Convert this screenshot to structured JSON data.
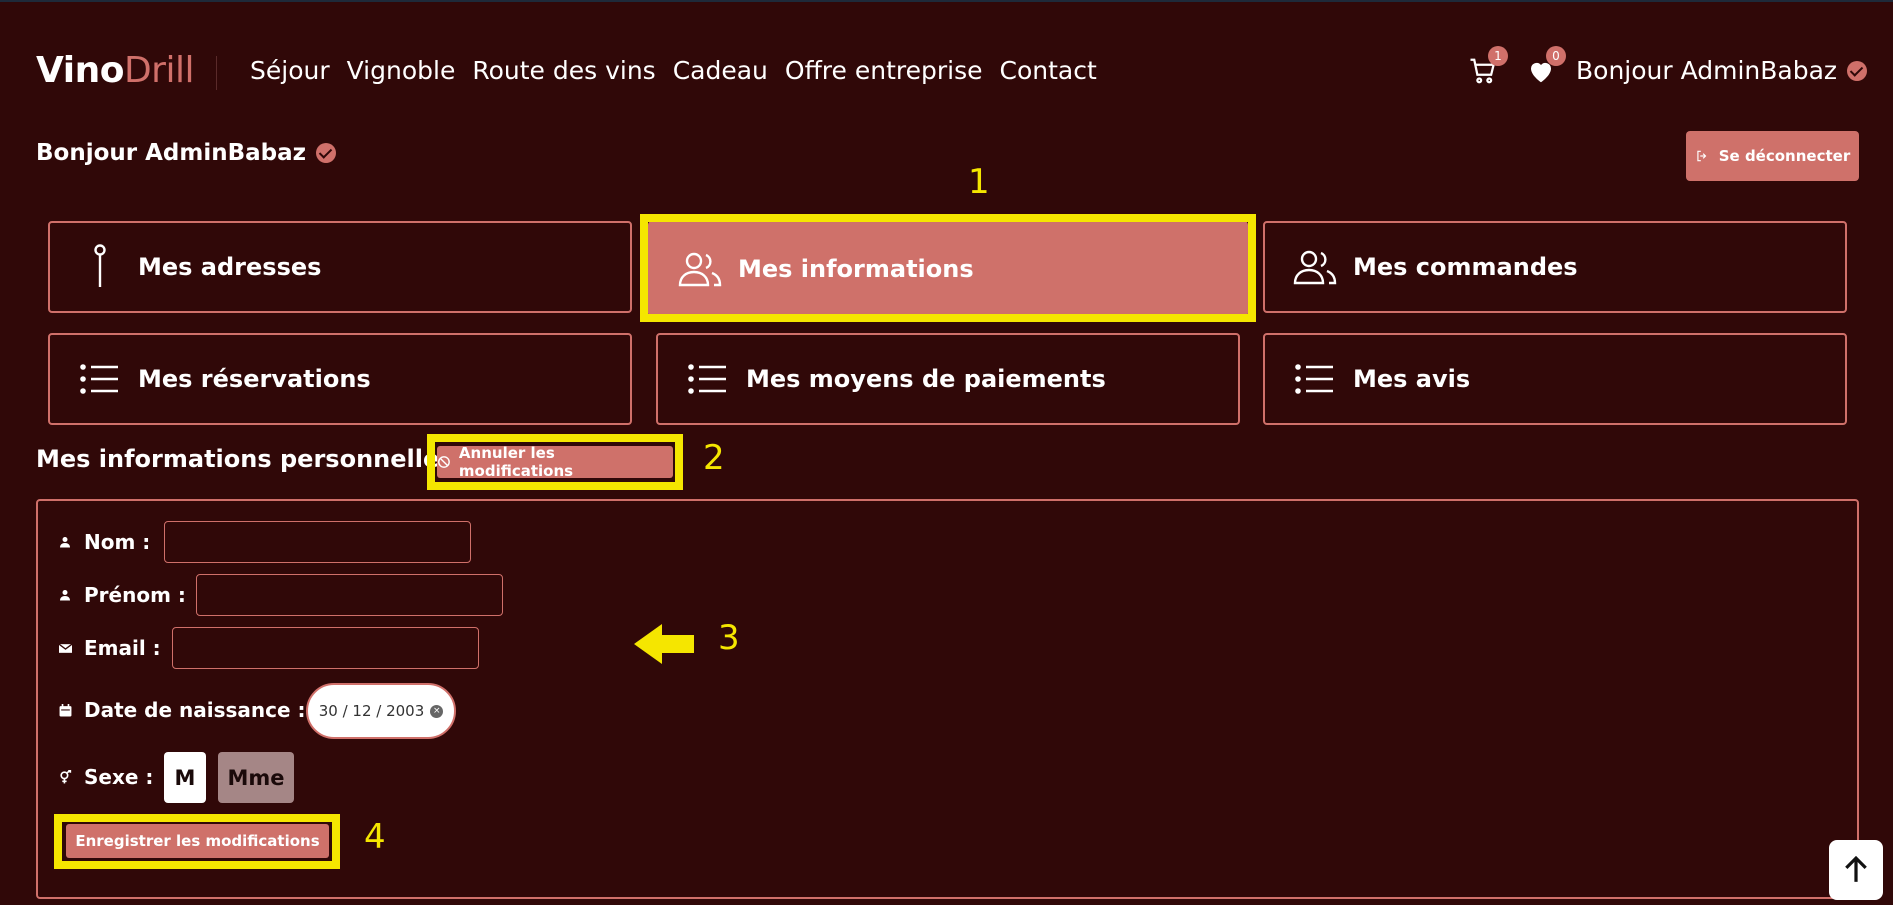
{
  "brand": {
    "part1": "Vino",
    "part2": "Drill"
  },
  "nav": [
    {
      "label": "Séjour"
    },
    {
      "label": "Vignoble"
    },
    {
      "label": "Route des vins"
    },
    {
      "label": "Cadeau"
    },
    {
      "label": "Offre entreprise"
    },
    {
      "label": "Contact"
    }
  ],
  "header": {
    "cart_count": "1",
    "wishlist_count": "0",
    "greeting": "Bonjour AdminBabaz"
  },
  "page": {
    "hello": "Bonjour AdminBabaz",
    "logout_label": "Se déconnecter"
  },
  "menu": {
    "addresses": "Mes adresses",
    "information": "Mes informations",
    "orders": "Mes commandes",
    "reservations": "Mes réservations",
    "payments": "Mes moyens de paiements",
    "reviews": "Mes avis"
  },
  "section": {
    "title": "Mes informations personnelles",
    "cancel_label": "Annuler les modifications"
  },
  "form": {
    "nom_label": "Nom :",
    "nom_value": "",
    "prenom_label": "Prénom :",
    "prenom_value": "",
    "email_label": "Email :",
    "email_value": "",
    "birth_label": "Date de naissance :",
    "birth_value": "30 / 12 / 2003",
    "sexe_label": "Sexe :",
    "sexe_m": "M",
    "sexe_mme": "Mme",
    "save_label": "Enregistrer les modifications"
  },
  "annotations": [
    "1",
    "2",
    "3",
    "4"
  ],
  "colors": {
    "background": "#300808",
    "accent": "#cf716a",
    "annotation": "#f5e600"
  }
}
